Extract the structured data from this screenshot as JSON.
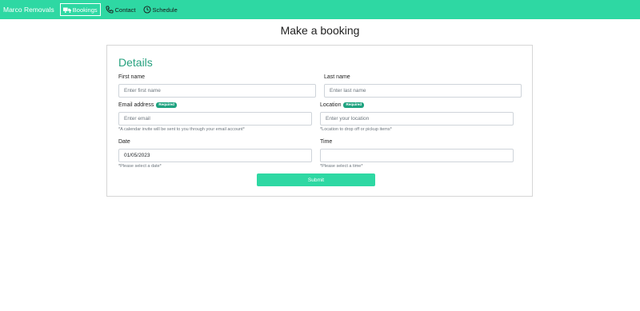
{
  "navbar": {
    "brand": "Marco Removals",
    "links": [
      {
        "label": "Bookings",
        "icon": "truck-icon",
        "active": true
      },
      {
        "label": "Contact",
        "icon": "phone-icon",
        "active": false
      },
      {
        "label": "Schedule",
        "icon": "clock-icon",
        "active": false
      }
    ],
    "bg_color": "#2ed8a3"
  },
  "page": {
    "title": "Make a booking"
  },
  "form": {
    "title": "Details",
    "required_badge": "Required",
    "first_name": {
      "label": "First name",
      "placeholder": "Enter first name"
    },
    "last_name": {
      "label": "Last name",
      "placeholder": "Enter last name"
    },
    "email": {
      "label": "Email address",
      "placeholder": "Enter email",
      "hint": "*A calendar invite will be sent to you through your email account*"
    },
    "location": {
      "label": "Location",
      "placeholder": "Enter your location",
      "hint": "*Location to drop off or pickup items*"
    },
    "date": {
      "label": "Date",
      "value": "01/05/2023",
      "hint": "*Please select a date*"
    },
    "time": {
      "label": "Time",
      "value": "",
      "hint": "*Please select a time*"
    },
    "submit_label": "Submit",
    "accent_color": "#2ed8a3"
  }
}
